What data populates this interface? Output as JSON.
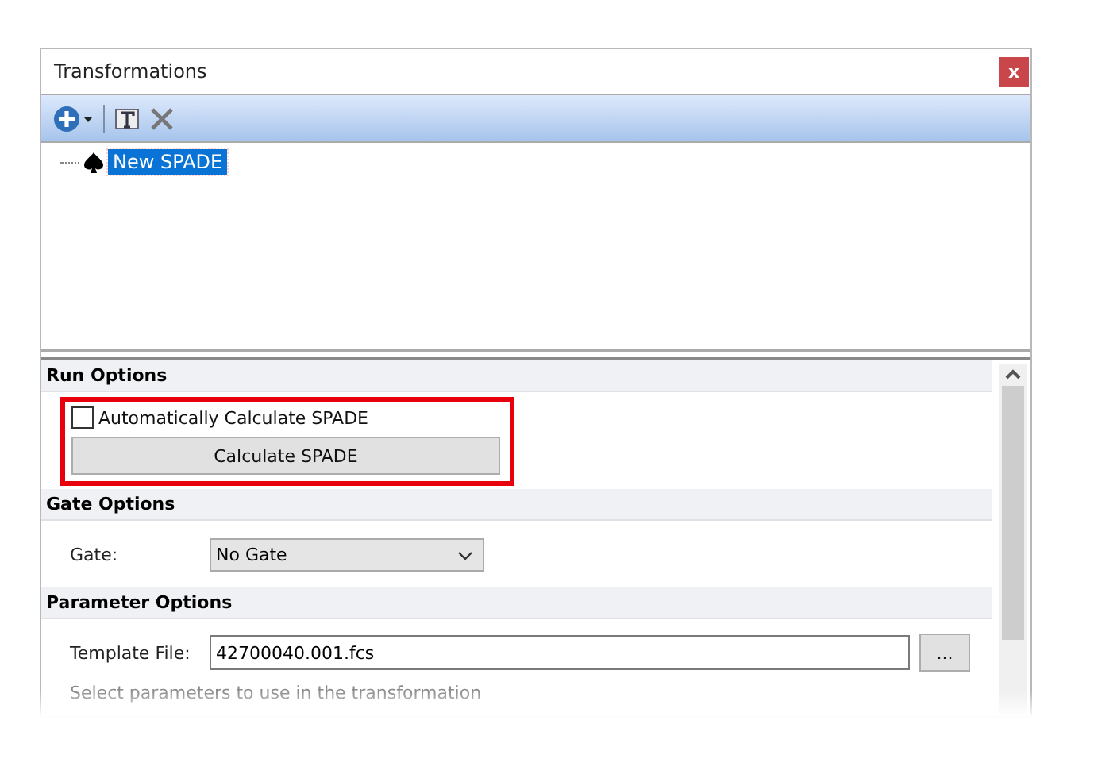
{
  "window": {
    "title": "Transformations",
    "close_glyph": "x"
  },
  "tree": {
    "items": [
      {
        "label": "New SPADE",
        "selected": true
      }
    ]
  },
  "run_options": {
    "header": "Run Options",
    "auto_calculate": {
      "label": "Automatically Calculate SPADE",
      "checked": false
    },
    "button": "Calculate SPADE"
  },
  "gate_options": {
    "header": "Gate Options",
    "label": "Gate:",
    "value": "No Gate"
  },
  "parameter_options": {
    "header": "Parameter Options",
    "template_label": "Template File:",
    "template_value": "42700040.001.fcs",
    "browse": "...",
    "hint": "Select parameters to use in the transformation"
  }
}
